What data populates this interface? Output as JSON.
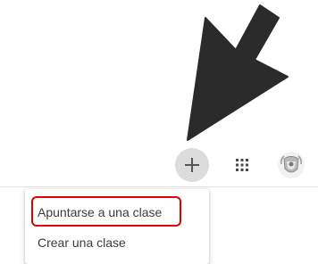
{
  "toolbar": {
    "add_icon": "plus-icon",
    "apps_icon": "grid-icon",
    "account_icon": "account-avatar"
  },
  "menu": {
    "items": [
      {
        "label": "Apuntarse a una clase",
        "highlighted": true
      },
      {
        "label": "Crear una clase",
        "highlighted": false
      }
    ]
  },
  "annotation": {
    "arrow_color": "#2b2b2b",
    "highlight_color": "#e10000"
  }
}
